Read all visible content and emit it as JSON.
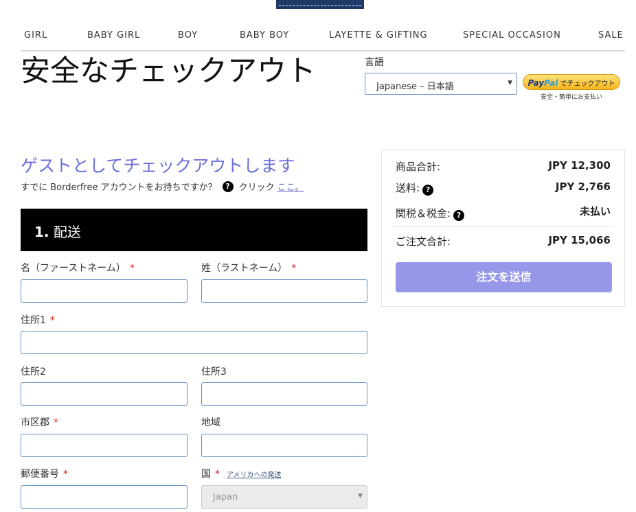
{
  "nav": {
    "items": [
      "GIRL",
      "BABY GIRL",
      "BOY",
      "BABY BOY",
      "LAYETTE & GIFTING",
      "SPECIAL OCCASION",
      "SALE"
    ]
  },
  "page": {
    "title": "安全なチェックアウト"
  },
  "language": {
    "label": "言語",
    "selected": "Japanese – 日本語"
  },
  "paypal": {
    "brand_part1": "Pay",
    "brand_part2": "Pal",
    "button_suffix": "でチェックアウト",
    "subtext": "安全・簡単にお支払い"
  },
  "guest": {
    "title": "ゲストとしてチェックアウトします",
    "account_question": "すでに Borderfree アカウントをお持ちですか？",
    "click_text": "クリック",
    "link_text": "ここ。"
  },
  "shipping": {
    "section_number": "1.",
    "section_title": "配送",
    "fields": {
      "first_name": "名（ファーストネーム）",
      "last_name": "姓（ラストネーム）",
      "address1": "住所1",
      "address2": "住所2",
      "address3": "住所3",
      "city": "市区郡",
      "region": "地域",
      "postal_code": "郵便番号",
      "country": "国"
    },
    "required_mark": "*",
    "us_shipping_link": "アメリカへの発送",
    "country_value": "Japan"
  },
  "summary": {
    "subtotal_label": "商品合計:",
    "subtotal_value": "JPY 12,300",
    "shipping_label": "送料:",
    "shipping_value": "JPY 2,766",
    "duties_label": "関税＆税金:",
    "duties_value": "未払い",
    "total_label": "ご注文合計:",
    "total_value": "JPY 15,066",
    "submit_label": "注文を送信"
  },
  "icons": {
    "help": "?",
    "dropdown": "▼"
  },
  "colors": {
    "accent": "#6b6fdb",
    "submit": "#9697e9",
    "required": "#dd2222",
    "header_bar": "#000000"
  }
}
